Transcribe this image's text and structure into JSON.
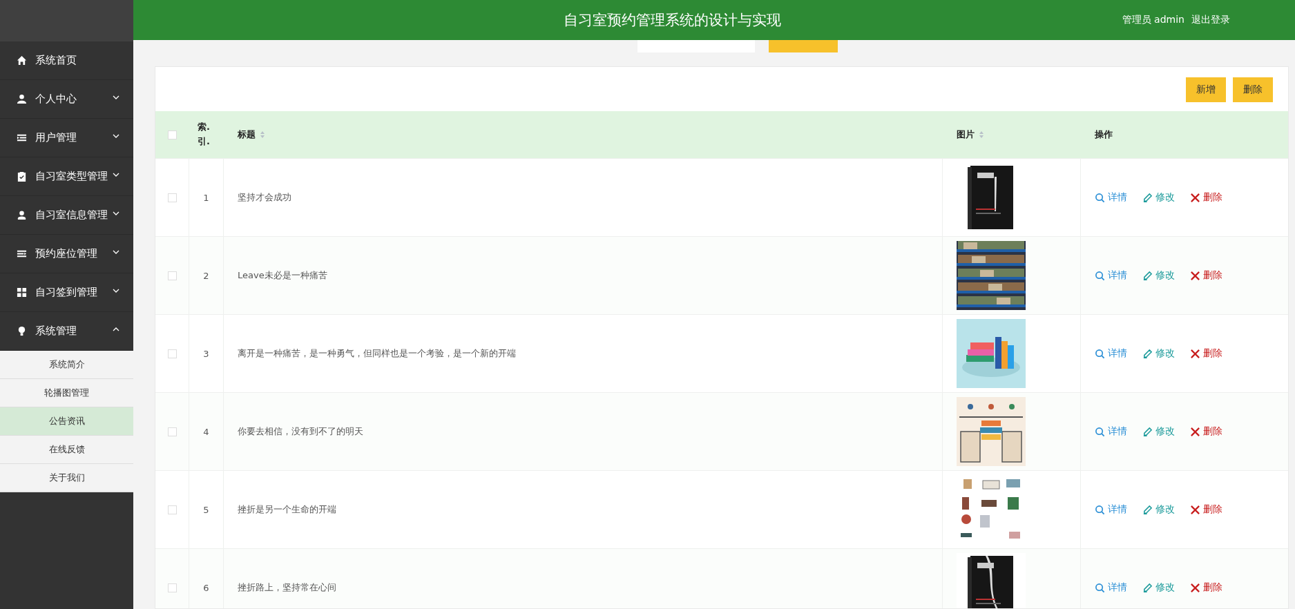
{
  "header": {
    "title": "自习室预约管理系统的设计与实现",
    "user": "管理员 admin",
    "logout": "退出登录"
  },
  "sidebar": {
    "items": [
      {
        "label": "系统首页",
        "has_children": false
      },
      {
        "label": "个人中心",
        "has_children": true,
        "expanded": false
      },
      {
        "label": "用户管理",
        "has_children": true,
        "expanded": false
      },
      {
        "label": "自习室类型管理",
        "has_children": true,
        "expanded": false
      },
      {
        "label": "自习室信息管理",
        "has_children": true,
        "expanded": false
      },
      {
        "label": "预约座位管理",
        "has_children": true,
        "expanded": false
      },
      {
        "label": "自习签到管理",
        "has_children": true,
        "expanded": false
      },
      {
        "label": "系统管理",
        "has_children": true,
        "expanded": true,
        "children": [
          {
            "label": "系统简介",
            "selected": false
          },
          {
            "label": "轮播图管理",
            "selected": false
          },
          {
            "label": "公告资讯",
            "selected": true
          },
          {
            "label": "在线反馈",
            "selected": false
          },
          {
            "label": "关于我们",
            "selected": false
          }
        ]
      }
    ]
  },
  "toolbar": {
    "buttons": [
      "新增",
      "删除"
    ]
  },
  "table": {
    "all_checked": false,
    "columns": [
      {
        "kind": "check"
      },
      {
        "label": "索.引.",
        "kind": "index"
      },
      {
        "label": "标题",
        "kind": "text",
        "sortable": true
      },
      {
        "label": "图片",
        "sortable": true
      },
      {
        "label": "操作",
        "kind": "actions"
      }
    ],
    "rows": [
      {
        "index": "1",
        "title": "坚持才会成功",
        "checked": false,
        "actions": [
          {
            "label": "详情",
            "kind": "detail"
          },
          {
            "label": "修改",
            "kind": "edit"
          },
          {
            "label": "删除",
            "kind": "delete"
          }
        ]
      },
      {
        "index": "2",
        "title": "Leave未必是一种痛苦",
        "checked": false,
        "actions": [
          {
            "label": "详情",
            "kind": "detail"
          },
          {
            "label": "修改",
            "kind": "edit"
          },
          {
            "label": "删除",
            "kind": "delete"
          }
        ]
      },
      {
        "index": "3",
        "title": "离开是一种痛苦，是一种勇气，但同样也是一个考验，是一个新的开端",
        "checked": false,
        "actions": [
          {
            "label": "详情",
            "kind": "detail"
          },
          {
            "label": "修改",
            "kind": "edit"
          },
          {
            "label": "删除",
            "kind": "delete"
          }
        ]
      },
      {
        "index": "4",
        "title": "你要去相信，没有到不了的明天",
        "checked": false,
        "actions": [
          {
            "label": "详情",
            "kind": "detail"
          },
          {
            "label": "修改",
            "kind": "edit"
          },
          {
            "label": "删除",
            "kind": "delete"
          }
        ]
      },
      {
        "index": "5",
        "title": "挫折是另一个生命的开端",
        "checked": false,
        "actions": [
          {
            "label": "详情",
            "kind": "detail"
          },
          {
            "label": "修改",
            "kind": "edit"
          },
          {
            "label": "删除",
            "kind": "delete"
          }
        ]
      },
      {
        "index": "6",
        "title": "挫折路上，坚持常在心间",
        "checked": false,
        "actions": [
          {
            "label": "详情",
            "kind": "detail"
          },
          {
            "label": "修改",
            "kind": "edit"
          },
          {
            "label": "删除",
            "kind": "delete"
          }
        ]
      }
    ]
  }
}
